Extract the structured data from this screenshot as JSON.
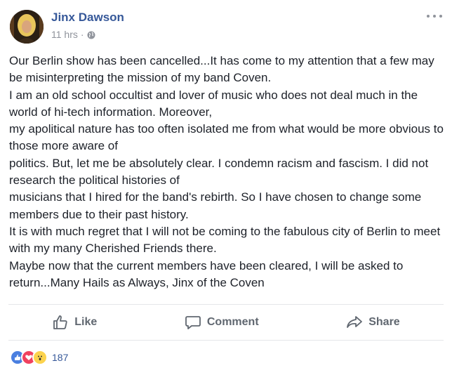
{
  "post": {
    "author": "Jinx Dawson",
    "time": "11 hrs",
    "separator": "·",
    "paragraphs": [
      "Our Berlin show has been cancelled...It has come to my attention that a few may be misinterpreting the mission of my band Coven.",
      "I am an old school occultist and lover of music who does not deal much in the world of hi-tech information. Moreover,",
      "my apolitical nature has too often isolated me from what would be more obvious to those more aware of",
      "politics. But, let me be absolutely clear. I condemn racism and fascism. I did not research the political histories of",
      "musicians that I hired for the band's rebirth. So I have chosen to change some members due to their past history.",
      "It is with much regret that I will not be coming to the fabulous city of Berlin to meet with my many Cherished Friends there.",
      "Maybe now that the current members have been cleared, I will be asked to return...Many Hails as Always, Jinx of the Coven"
    ]
  },
  "actions": {
    "like_label": "Like",
    "comment_label": "Comment",
    "share_label": "Share"
  },
  "reactions": {
    "count": "187",
    "icons": [
      "like-reaction-icon",
      "love-reaction-icon",
      "wow-reaction-icon"
    ]
  },
  "colors": {
    "author": "#365899",
    "text": "#1d2129",
    "muted": "#90949c",
    "action": "#606770"
  }
}
